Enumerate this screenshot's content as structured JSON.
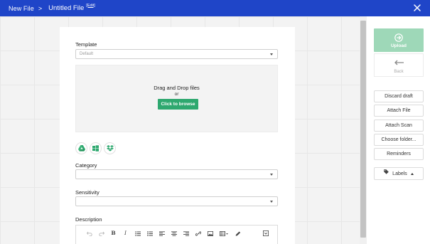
{
  "header": {
    "breadcrumb_root": "New File",
    "separator": ">",
    "file_title": "Untitled File",
    "edit_label": "[Edit]",
    "close_icon": "close-icon"
  },
  "form": {
    "template": {
      "label": "Template",
      "value": "Default"
    },
    "dropzone": {
      "main_text": "Drag and Drop files",
      "or_text": "or",
      "browse_label": "Click to browse"
    },
    "cloud_sources": [
      "google-drive-icon",
      "onedrive-icon",
      "dropbox-icon"
    ],
    "category": {
      "label": "Category",
      "value": ""
    },
    "sensitivity": {
      "label": "Sensitivity",
      "value": ""
    },
    "description": {
      "label": "Description"
    },
    "toolbar_icons": [
      "undo-icon",
      "redo-icon",
      "bold-icon",
      "italic-icon",
      "bulleted-list-icon",
      "numbered-list-icon",
      "align-left-icon",
      "align-center-icon",
      "align-right-icon",
      "link-icon",
      "image-icon",
      "table-icon",
      "pen-icon",
      "expand-icon"
    ],
    "toolbar_text": {
      "bold": "B",
      "italic": "I"
    }
  },
  "sidebar": {
    "upload_label": "Upload",
    "back_label": "Back",
    "actions": [
      "Discard draft",
      "Attach File",
      "Attach Scan",
      "Choose folder...",
      "Reminders"
    ],
    "labels_label": "Labels"
  },
  "colors": {
    "header_bg": "#1f45c8",
    "browse_green": "#2ea86f",
    "upload_green_disabled": "#9ed8b8"
  }
}
